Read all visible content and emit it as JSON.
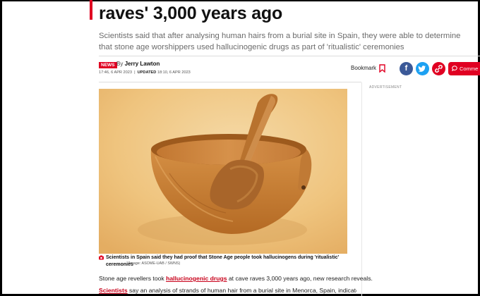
{
  "article": {
    "headline": "raves' 3,000 years ago",
    "standfirst": "Scientists said that after analysing human hairs from a burial site in Spain, they were able to determine that stone age worshippers used hallucinogenic drugs as part of 'ritualistic' ceremonies",
    "badge": "NEWS",
    "by": "By",
    "author": "Jerry Lawton",
    "published": "17:46, 6 APR 2023",
    "updated_label": "UPDATED",
    "updated": "18:10, 6 APR 2023"
  },
  "actions": {
    "bookmark": "Bookmark",
    "comments": "Comme"
  },
  "sidebar": {
    "ad_label": "ADVERTISEMENT"
  },
  "image": {
    "caption": "Scientists in Spain said they had proof that Stone Age people took hallucinogens during 'ritualistic' ceremonies",
    "credit": "(Image: ASOME-UAB / SWNS)"
  },
  "body": {
    "p1_before": "Stone age revellers took ",
    "p1_link": "hallucinogenic drugs",
    "p1_after": " at cave raves 3,000 years ago, new research reveals.",
    "p2_link": "Scientists",
    "p2_after": " say an analysis of strands of human hair from a burial site in Menorca, Spain, indicates"
  },
  "colors": {
    "brand_red": "#e00022",
    "facebook": "#3b5998",
    "twitter": "#1da1f2"
  }
}
